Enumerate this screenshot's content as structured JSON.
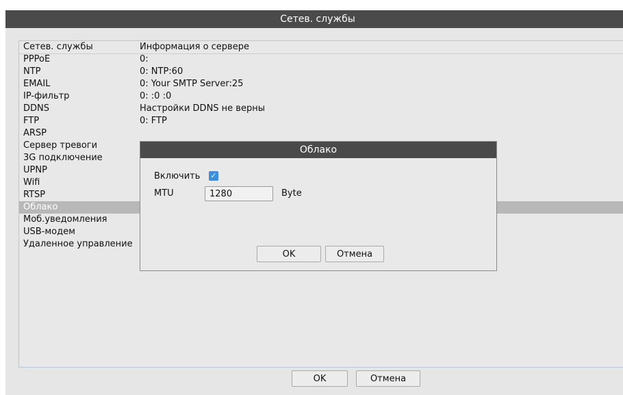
{
  "window": {
    "title": "Сетев. службы",
    "ok_label": "OK",
    "cancel_label": "Отмена"
  },
  "list": {
    "header": {
      "name": "Сетев. службы",
      "info": "Информация о сервере"
    },
    "rows": [
      {
        "name": "PPPoE",
        "info": "0:"
      },
      {
        "name": "NTP",
        "info": "0: NTP:60"
      },
      {
        "name": "EMAIL",
        "info": "0: Your SMTP Server:25"
      },
      {
        "name": "IP-фильтр",
        "info": "0: :0 :0"
      },
      {
        "name": "DDNS",
        "info": "Настройки DDNS не верны"
      },
      {
        "name": "FTP",
        "info": "0: FTP"
      },
      {
        "name": "ARSP",
        "info": ""
      },
      {
        "name": "Сервер тревоги",
        "info": ""
      },
      {
        "name": "3G подключение",
        "info": ""
      },
      {
        "name": "UPNP",
        "info": ""
      },
      {
        "name": "Wifi",
        "info": ""
      },
      {
        "name": "RTSP",
        "info": ""
      },
      {
        "name": "Облако",
        "info": "",
        "selected": true
      },
      {
        "name": "Моб.уведомления",
        "info": ""
      },
      {
        "name": "USB-модем",
        "info": ""
      },
      {
        "name": "Удаленное управление",
        "info": ""
      }
    ]
  },
  "dialog": {
    "title": "Облако",
    "enable_label": "Включить",
    "enable_checked": true,
    "mtu_label": "MTU",
    "mtu_value": "1280",
    "mtu_unit": "Byte",
    "ok_label": "OK",
    "cancel_label": "Отмена"
  },
  "colors": {
    "titlebar": "#4a4a4a",
    "selected_row": "#b8b8b8",
    "checkbox": "#3a8fe0",
    "panel_border": "#b9c6d6"
  }
}
